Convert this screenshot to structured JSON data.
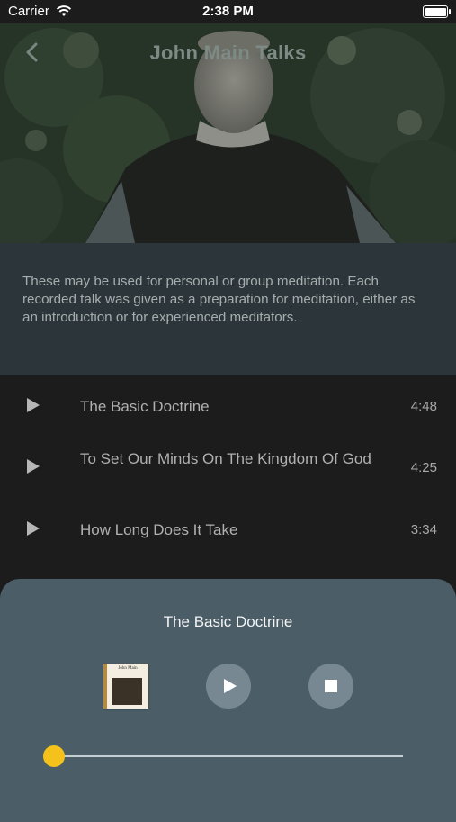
{
  "status_bar": {
    "carrier": "Carrier",
    "time": "2:38 PM"
  },
  "header": {
    "title": "John Main Talks"
  },
  "description": "These may be used for personal or group meditation. Each recorded talk was given as a preparation for meditation, either as an introduction or for experienced meditators.",
  "talks": [
    {
      "title": "The Basic Doctrine",
      "duration": "4:48"
    },
    {
      "title": "To Set Our Minds On The Kingdom Of God",
      "duration": "4:25"
    },
    {
      "title": "How Long Does It Take",
      "duration": "3:34"
    }
  ],
  "player": {
    "now_playing": "The Basic Doctrine",
    "cover_text": "John Main",
    "progress_fraction": 0.0,
    "accent_color": "#f4c21a"
  }
}
